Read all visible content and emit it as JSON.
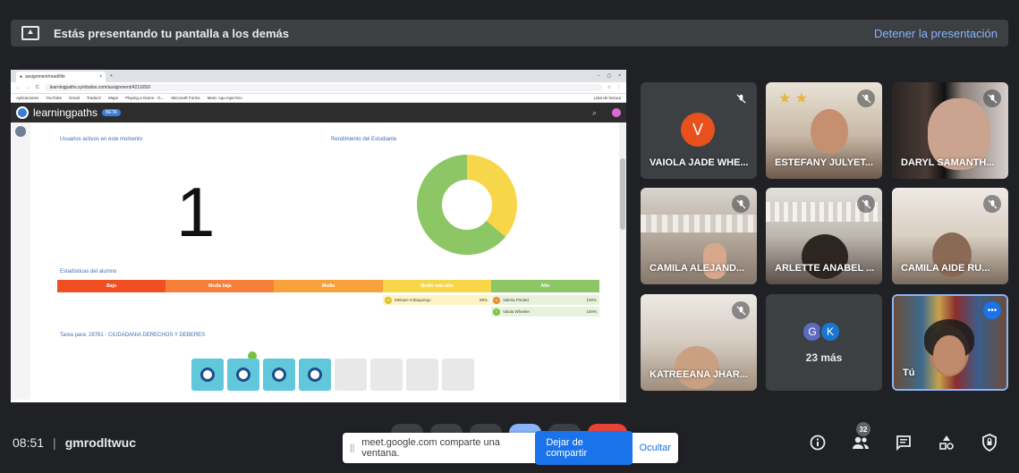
{
  "banner": {
    "title": "Estás presentando tu pantalla a los demás",
    "stop_label": "Detener la presentación",
    "icon": "present-screen-icon"
  },
  "shared_browser": {
    "tab_title": "assignment/read/life",
    "url": "learningpaths.symbaloo.com/assignment/4211650/",
    "bookmarks": [
      "Aplicaciones",
      "YouTube",
      "Gmail",
      "Traducir",
      "Maps",
      "Playing a Game - G...",
      "Microsoft Forms",
      "Meet: nqu-mpe-bzo",
      "Lista de lectura"
    ],
    "app_name": "learningpaths",
    "app_subtitle": "by symbaloo",
    "beta_label": "BETA",
    "active_users_label": "Usuarios activos en este momento",
    "active_users_value": "1",
    "performance_label": "Rendimiento del Estudiante",
    "stats_label": "Estadísticas del alumno",
    "levels": [
      "Bajo",
      "Media baja",
      "Media",
      "Medio más alto",
      "Alto"
    ],
    "level_colors": [
      "#f04e23",
      "#f77f3a",
      "#f7a23a",
      "#f7d64a",
      "#8cc665"
    ],
    "students": [
      {
        "initial": "M",
        "name": "Melanie Imbaquingo",
        "pct": "98%"
      },
      {
        "initial": "V",
        "name": "Valeria Piedad",
        "pct": "100%"
      },
      {
        "initial": "V",
        "name": "Vaiola Wheeler",
        "pct": "100%"
      }
    ],
    "task_label": "Tarea para: 28761 - CIUDADANIA DERECHOS Y DEBERES",
    "donut": {
      "green_fraction": 0.64,
      "yellow_fraction": 0.36,
      "green": "#8cc665",
      "yellow": "#f7d64a"
    }
  },
  "participants": [
    {
      "name": "VAIOLA JADE WHE...",
      "avatar_letter": "V",
      "muted": true
    },
    {
      "name": "ESTEFANY JULYET...",
      "muted": true
    },
    {
      "name": "DARYL SAMANTH...",
      "muted": true
    },
    {
      "name": "CAMILA ALEJAND...",
      "muted": true
    },
    {
      "name": "ARLETTE ANABEL ...",
      "muted": true
    },
    {
      "name": "CAMILA AIDE RU...",
      "muted": true
    },
    {
      "name": "KATREEANA JHAR...",
      "muted": true
    },
    {
      "more_avatars": [
        "G",
        "K"
      ],
      "more_label": "23 más"
    },
    {
      "name": "Tú",
      "menu_label": "•••"
    }
  ],
  "bottom": {
    "time": "08:51",
    "separator": "|",
    "meeting_code": "gmrodltwuc",
    "share_message": "meet.google.com comparte una ventana.",
    "stop_sharing_label": "Dejar de compartir",
    "hide_label": "Ocultar",
    "grip": "||",
    "participants_count": "32"
  }
}
